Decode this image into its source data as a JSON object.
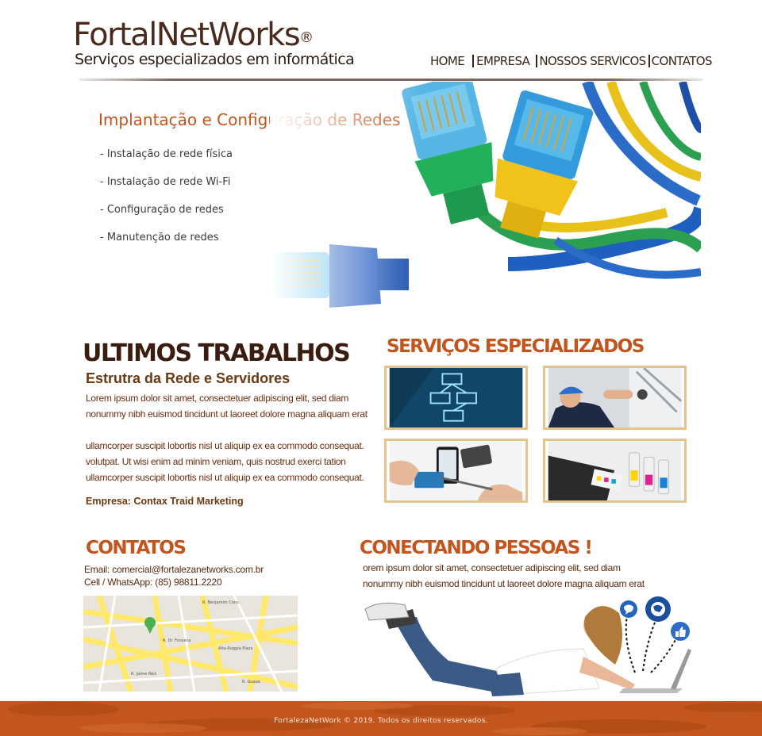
{
  "header": {
    "logo_name": "FortalNetWorks",
    "logo_registered": "®",
    "logo_tagline": "Serviços especializados em informática"
  },
  "nav": {
    "items": [
      "HOME",
      "EMPRESA",
      "NOSSOS SERVICOS",
      "CONTATOS"
    ]
  },
  "banner": {
    "title": "Implantação e Configuração de Redes",
    "items": [
      "- Instalação de rede física",
      "- Instalação de rede Wi-Fi",
      "- Configuração de redes",
      "- Manutenção de redes"
    ]
  },
  "ultimos_trabalhos": {
    "title": "ULTIMOS TRABALHOS",
    "subtitle": "Estrutra da Rede e Servidores",
    "paragraph1": [
      "Lorem ipsum dolor sit amet, consectetuer adipiscing elit, sed diam",
      "nonummy nibh euismod tincidunt ut laoreet dolore magna aliquam erat"
    ],
    "paragraph2": [
      "ullamcorper suscipit lobortis nisl ut aliquip ex ea commodo consequat.",
      "volutpat. Ut wisi enim ad minim veniam, quis nostrud exerci tation",
      "ullamcorper suscipit lobortis nisl ut aliquip ex ea commodo consequat."
    ],
    "company": "Empresa: Contax Traid Marketing"
  },
  "servicos": {
    "title": "SERVIÇOS ESPECIALIZADOS"
  },
  "contatos": {
    "title": "CONTATOS",
    "email": "Email: comercial@fortalezanetworks.com.br",
    "phone": "Cell / WhatsApp: (85) 98811.2220"
  },
  "conectando": {
    "title": "CONECTANDO PESSOAS !",
    "paragraph": [
      "orem ipsum dolor sit amet, consectetuer adipiscing elit, sed diam",
      "nonummy nibh euismod tincidunt ut laoreet dolore magna aliquam erat"
    ]
  },
  "footer": {
    "text": "FortalezaNetWork © 2019. Todos os direitos reservados."
  },
  "colors": {
    "accent": "#c4541c",
    "heading_dark": "#3a1d0e",
    "body_text": "#6b2e10",
    "thumb_border": "#e3c48b",
    "footer_bg": "#c2561e"
  }
}
